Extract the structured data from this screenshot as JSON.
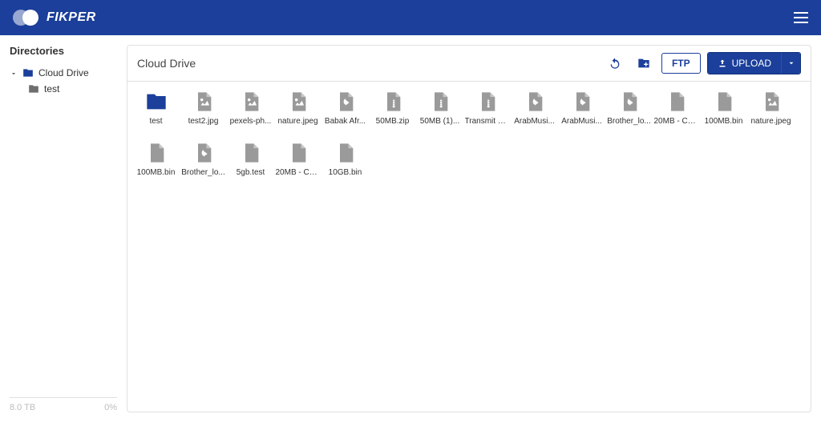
{
  "brand": "FIKPER",
  "sidebar": {
    "title": "Directories",
    "items": [
      {
        "label": "Cloud Drive",
        "expanded": true,
        "color": "blue"
      },
      {
        "label": "test",
        "color": "grey",
        "child": true
      }
    ],
    "storage": {
      "used": "8.0 TB",
      "pct": "0%"
    }
  },
  "main": {
    "breadcrumb": "Cloud Drive",
    "toolbar": {
      "ftp_label": "FTP",
      "upload_label": "UPLOAD"
    },
    "files": [
      {
        "label": "test",
        "type": "folder"
      },
      {
        "label": "test2.jpg",
        "type": "image"
      },
      {
        "label": "pexels-ph...",
        "type": "image"
      },
      {
        "label": "nature.jpeg",
        "type": "image"
      },
      {
        "label": "Babak Afr...",
        "type": "audio"
      },
      {
        "label": "50MB.zip",
        "type": "zip"
      },
      {
        "label": "50MB (1)...",
        "type": "zip"
      },
      {
        "label": "Transmit S...",
        "type": "zip"
      },
      {
        "label": "ArabMusi...",
        "type": "audio"
      },
      {
        "label": "ArabMusi...",
        "type": "audio"
      },
      {
        "label": "Brother_lo...",
        "type": "audio"
      },
      {
        "label": "20MB - Co...",
        "type": "file"
      },
      {
        "label": "100MB.bin",
        "type": "file"
      },
      {
        "label": "nature.jpeg",
        "type": "image"
      },
      {
        "label": "100MB.bin",
        "type": "file"
      },
      {
        "label": "Brother_lo...",
        "type": "audio"
      },
      {
        "label": "5gb.test",
        "type": "file"
      },
      {
        "label": "20MB - Co...",
        "type": "file"
      },
      {
        "label": "10GB.bin",
        "type": "file"
      }
    ]
  }
}
